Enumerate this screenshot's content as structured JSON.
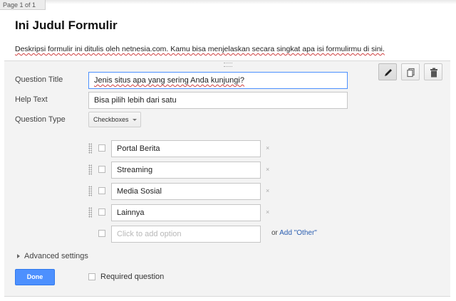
{
  "page_indicator": "Page 1 of 1",
  "form": {
    "title": "Ini Judul Formulir",
    "description": "Deskripsi formulir ini ditulis oleh netnesia.com. Kamu bisa menjelaskan secara singkat apa isi formulirmu di sini."
  },
  "toolbar": {
    "icons": [
      "pencil-icon",
      "duplicate-icon",
      "trash-icon"
    ]
  },
  "question": {
    "title_label": "Question Title",
    "title_value": "Jenis situs apa yang sering Anda kunjungi?",
    "help_label": "Help Text",
    "help_value": "Bisa pilih lebih dari satu",
    "type_label": "Question Type",
    "type_value": "Checkboxes"
  },
  "options": [
    {
      "label": "Portal Berita",
      "remove": "×"
    },
    {
      "label": "Streaming",
      "remove": "×"
    },
    {
      "label": "Media Sosial",
      "remove": "×"
    },
    {
      "label": "Lainnya",
      "remove": "×"
    }
  ],
  "add_option": {
    "placeholder": "Click to add option",
    "or_text": "or",
    "add_other_link": "Add \"Other\""
  },
  "advanced_settings": "Advanced settings",
  "done_button": "Done",
  "required_label": "Required question",
  "colors": {
    "primary_button": "#4d90fe",
    "link": "#2a5db0",
    "focus_border": "#4d90fe"
  }
}
